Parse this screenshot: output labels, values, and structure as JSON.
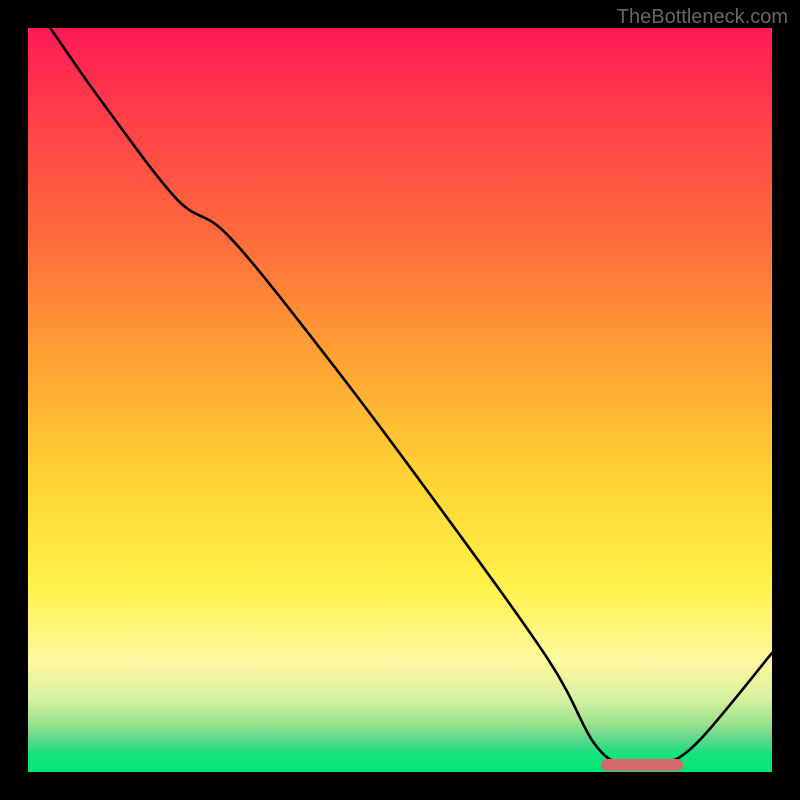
{
  "watermark": "TheBottleneck.com",
  "chart_data": {
    "type": "line",
    "title": "",
    "xlabel": "",
    "ylabel": "",
    "xlim": [
      0,
      100
    ],
    "ylim": [
      0,
      100
    ],
    "grid": false,
    "legend": false,
    "x": [
      3,
      10,
      20,
      27,
      40,
      55,
      70,
      76,
      80,
      85,
      90,
      100
    ],
    "values": [
      100,
      90,
      77,
      72,
      56,
      36,
      15,
      4,
      1,
      1,
      4,
      16
    ],
    "optimal_zone": {
      "x_start": 77,
      "x_end": 88,
      "y": 1
    },
    "gradient_stops": [
      {
        "pos": 0.0,
        "color": "#ff1a55"
      },
      {
        "pos": 0.28,
        "color": "#ff6a3c"
      },
      {
        "pos": 0.6,
        "color": "#ffd233"
      },
      {
        "pos": 0.85,
        "color": "#fff9a0"
      },
      {
        "pos": 0.96,
        "color": "#4fd88a"
      },
      {
        "pos": 1.0,
        "color": "#00e676"
      }
    ]
  }
}
